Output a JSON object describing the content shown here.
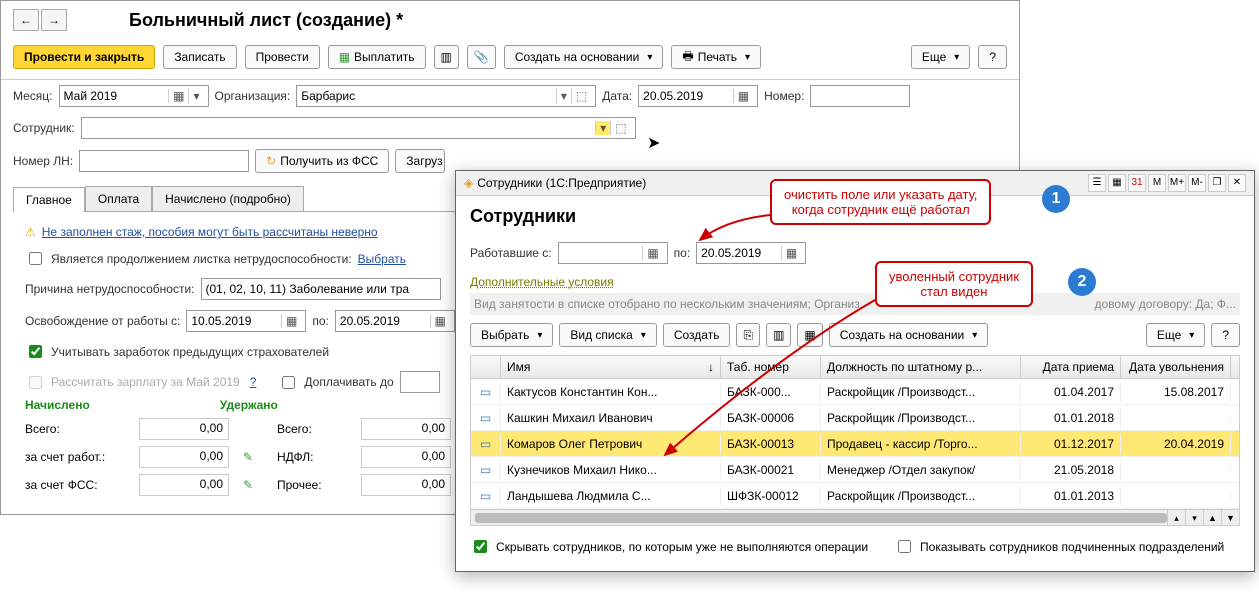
{
  "main": {
    "title": "Больничный лист (создание) *",
    "toolbar": {
      "post_close": "Провести и закрыть",
      "save": "Записать",
      "post": "Провести",
      "pay": "Выплатить",
      "create_basis": "Создать на основании",
      "print": "Печать",
      "more": "Еще",
      "help": "?"
    },
    "fields": {
      "month_lbl": "Месяц:",
      "month_val": "Май 2019",
      "org_lbl": "Организация:",
      "org_val": "Барбарис",
      "date_lbl": "Дата:",
      "date_val": "20.05.2019",
      "num_lbl": "Номер:",
      "num_val": "",
      "emp_lbl": "Сотрудник:",
      "ln_lbl": "Номер ЛН:",
      "get_fss": "Получить из ФСС",
      "load_file": "Загруз"
    },
    "tabs": {
      "t1": "Главное",
      "t2": "Оплата",
      "t3": "Начислено (подробно)"
    },
    "warn": "Не заполнен стаж, пособия могут быть рассчитаны неверно",
    "cont_lbl": "Является продолжением листка нетрудоспособности:",
    "cont_pick": "Выбрать",
    "reason_lbl": "Причина нетрудоспособности:",
    "reason_val": "(01, 02, 10, 11) Заболевание или тра",
    "off_lbl": "Освобождение от работы с:",
    "off_from": "10.05.2019",
    "off_to_lbl": "по:",
    "off_to": "20.05.2019",
    "prev_insurers": "Учитывать заработок предыдущих страхователей",
    "calc_may": "Рассчитать зарплату за Май 2019",
    "addpay_lbl": "Доплачивать до",
    "totals": {
      "accrued": "Начислено",
      "withheld": "Удержано",
      "total_lbl": "Всего:",
      "total1": "0,00",
      "total2": "0,00",
      "emp_lbl": "за счет работ.:",
      "emp": "0,00",
      "ndfl_lbl": "НДФЛ:",
      "ndfl": "0,00",
      "fss_lbl": "за счет ФСС:",
      "fss": "0,00",
      "other_lbl": "Прочее:",
      "other": "0,00"
    }
  },
  "popup": {
    "title": "Сотрудники  (1С:Предприятие)",
    "win_btns": {
      "m": "M",
      "mp": "M+",
      "mm": "M-"
    },
    "h1": "Сотрудники",
    "worked_lbl": "Работавшие с:",
    "worked_to_lbl": "по:",
    "worked_to": "20.05.2019",
    "add_cond": "Дополнительные условия",
    "filter_info": "Вид занятости в списке отобрано по нескольким значениям; Организ",
    "filter_tail": "довому договору: Да; Ф...",
    "tb": {
      "select": "Выбрать",
      "viewlist": "Вид списка",
      "create": "Создать",
      "basis": "Создать на основании",
      "more": "Еще",
      "help": "?"
    },
    "cols": {
      "name": "Имя",
      "tab": "Таб. номер",
      "pos": "Должность по штатному р...",
      "hire": "Дата приема",
      "fire": "Дата увольнения"
    },
    "rows": [
      {
        "name": "Кактусов Константин Кон...",
        "tab": "БАЗК-000...",
        "pos": "Раскройщик /Производст...",
        "hire": "01.04.2017",
        "fire": "15.08.2017"
      },
      {
        "name": "Кашкин Михаил Иванович",
        "tab": "БАЗК-00006",
        "pos": "Раскройщик /Производст...",
        "hire": "01.01.2018",
        "fire": ""
      },
      {
        "name": "Комаров Олег Петрович",
        "tab": "БАЗК-00013",
        "pos": "Продавец - кассир /Торго...",
        "hire": "01.12.2017",
        "fire": "20.04.2019"
      },
      {
        "name": "Кузнечиков Михаил Нико...",
        "tab": "БАЗК-00021",
        "pos": "Менеджер /Отдел закупок/",
        "hire": "21.05.2018",
        "fire": ""
      },
      {
        "name": "Ландышева Людмила С...",
        "tab": "ШФЗК-00012",
        "pos": "Раскройщик /Производст...",
        "hire": "01.01.2013",
        "fire": ""
      }
    ],
    "hide_chk": "Скрывать сотрудников, по которым уже не выполняются операции",
    "show_sub": "Показывать сотрудников подчиненных подразделений"
  },
  "callouts": {
    "c1": "очистить поле или указать дату,\nкогда сотрудник ещё работал",
    "c2": "уволенный сотрудник\nстал виден"
  }
}
